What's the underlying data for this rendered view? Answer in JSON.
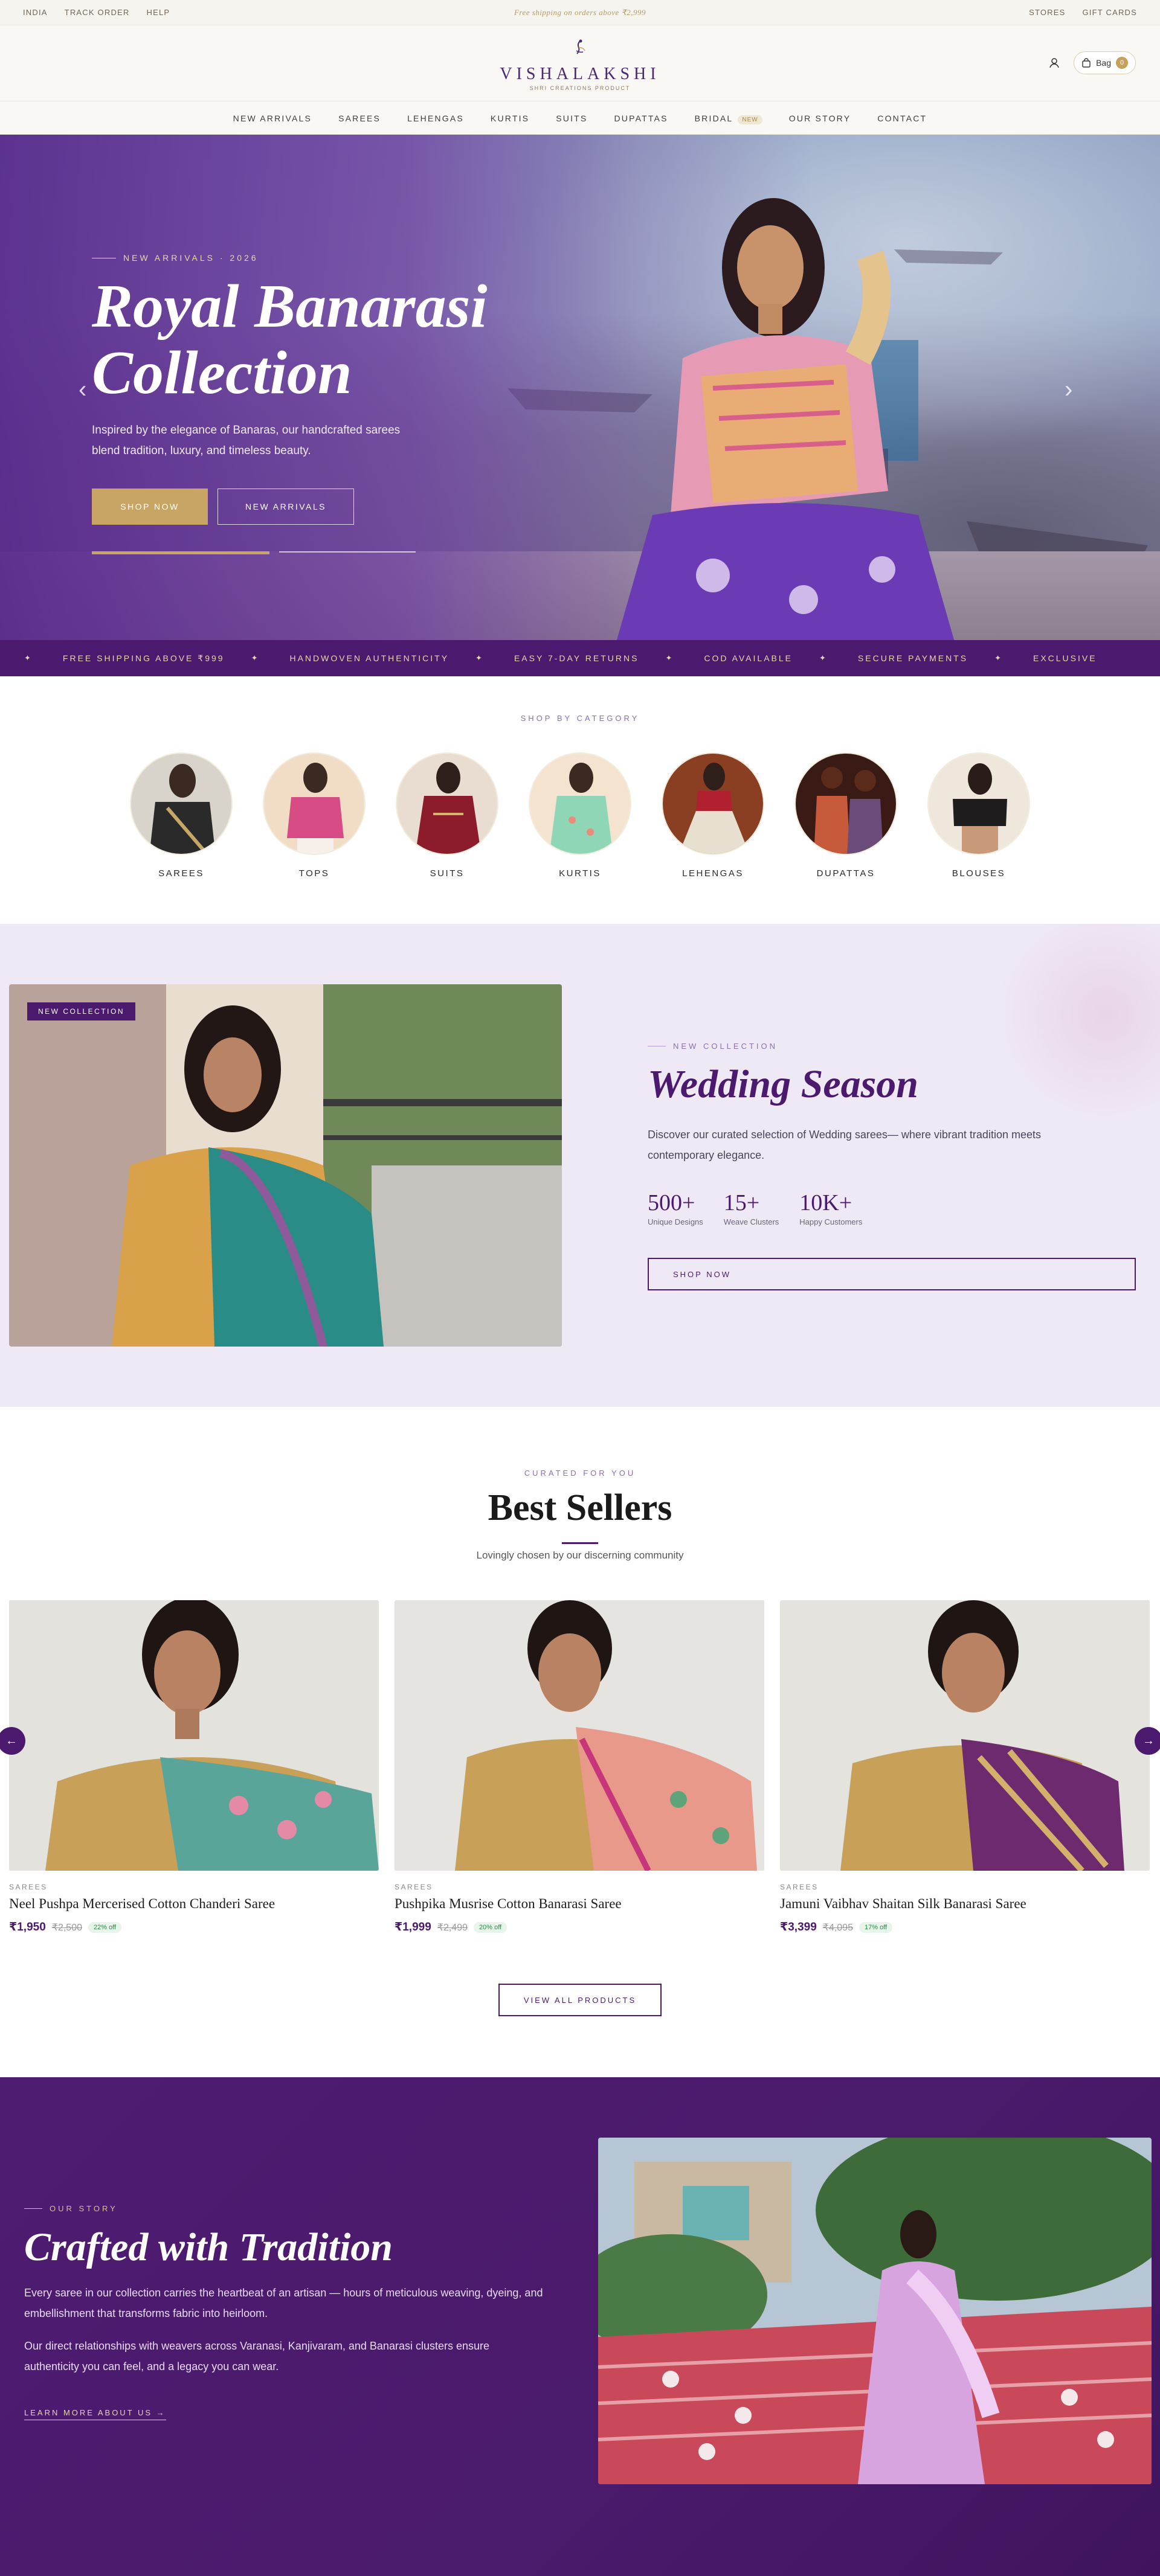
{
  "utility": {
    "left_links": [
      "INDIA",
      "TRACK ORDER",
      "HELP"
    ],
    "promo": "Free shipping on orders above ₹2,999",
    "right_links": [
      "STORES",
      "GIFT CARDS"
    ]
  },
  "header": {
    "brand": "VISHALAKSHI",
    "brand_sub": "SHRI CREATIONS PRODUCT",
    "bag_label": "Bag",
    "bag_count": "0"
  },
  "nav": {
    "items": [
      "NEW ARRIVALS",
      "SAREES",
      "LEHENGAS",
      "KURTIS",
      "SUITS",
      "DUPATTAS",
      "BRIDAL",
      "OUR STORY",
      "CONTACT"
    ],
    "bridal_tag": "NEW"
  },
  "hero": {
    "eyebrow": "NEW ARRIVALS · 2026",
    "title_line1": "Royal Banarasi",
    "title_line2": "Collection",
    "description": "Inspired by the elegance of Banaras, our handcrafted sarees blend tradition, luxury, and timeless beauty.",
    "cta_primary": "SHOP NOW",
    "cta_secondary": "NEW ARRIVALS"
  },
  "marquee": {
    "items": [
      "FREE SHIPPING ABOVE ₹999",
      "HANDWOVEN AUTHENTICITY",
      "EASY 7-DAY RETURNS",
      "COD AVAILABLE",
      "SECURE PAYMENTS",
      "EXCLUSIVE"
    ]
  },
  "categories": {
    "eyebrow": "SHOP BY CATEGORY",
    "items": [
      "SAREES",
      "TOPS",
      "SUITS",
      "KURTIS",
      "LEHENGAS",
      "DUPATTAS",
      "BLOUSES"
    ]
  },
  "wedding": {
    "badge": "NEW COLLECTION",
    "eyebrow": "NEW COLLECTION",
    "title": "Wedding Season",
    "description": "Discover our curated selection of Wedding sarees— where vibrant tradition meets contemporary elegance.",
    "stats": [
      {
        "value": "500+",
        "label": "Unique Designs"
      },
      {
        "value": "15+",
        "label": "Weave Clusters"
      },
      {
        "value": "10K+",
        "label": "Happy Customers"
      }
    ],
    "cta": "SHOP NOW"
  },
  "best_sellers": {
    "eyebrow": "CURATED FOR YOU",
    "title": "Best Sellers",
    "subtitle": "Lovingly chosen by our discerning community",
    "products": [
      {
        "category": "SAREES",
        "title": "Neel Pushpa Mercerised Cotton Chanderi Saree",
        "price": "₹1,950",
        "mrp": "₹2,500",
        "discount": "22% off"
      },
      {
        "category": "SAREES",
        "title": "Pushpika Musrise Cotton Banarasi Saree",
        "price": "₹1,999",
        "mrp": "₹2,499",
        "discount": "20% off"
      },
      {
        "category": "SAREES",
        "title": "Jamuni Vaibhav Shaitan Silk Banarasi Saree",
        "price": "₹3,399",
        "mrp": "₹4,095",
        "discount": "17% off"
      }
    ],
    "view_all": "VIEW ALL PRODUCTS"
  },
  "story": {
    "eyebrow": "OUR STORY",
    "title": "Crafted with Tradition",
    "para1": "Every saree in our collection carries the heartbeat of an artisan — hours of meticulous weaving, dyeing, and embellishment that transforms fabric into heirloom.",
    "para2": "Our direct relationships with weavers across Varanasi, Kanjivaram, and Banarasi clusters ensure authenticity you can feel, and a legacy you can wear.",
    "link": "LEARN MORE ABOUT US →"
  },
  "colors": {
    "brand_purple": "#4b1a6e",
    "gold": "#c8a562",
    "lavender_bg": "#efe9f6",
    "cream": "#faf8f4"
  }
}
